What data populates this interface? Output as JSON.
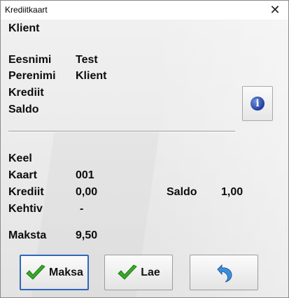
{
  "window": {
    "title": "Krediitkaart",
    "close_label": "✕"
  },
  "section_title": "Klient",
  "client": {
    "first_name_label": "Eesnimi",
    "first_name": "Test",
    "last_name_label": "Perenimi",
    "last_name": "Klient",
    "credit_label": "Krediit",
    "balance_label": "Saldo"
  },
  "card": {
    "language_label": "Keel",
    "card_label": "Kaart",
    "card_number": "001",
    "credit_label": "Krediit",
    "credit": "0,00",
    "balance_label": "Saldo",
    "balance": "1,00",
    "valid_label": "Kehtiv",
    "valid": "-",
    "pay_label": "Maksta",
    "pay_amount": "9,50"
  },
  "buttons": {
    "pay": "Maksa",
    "load": "Lae",
    "info_icon": "info-icon",
    "undo_icon": "undo-arrow-icon"
  },
  "colors": {
    "default_button_border": "#2f67b8",
    "check": "#3aa82a",
    "undo": "#3b8fd6"
  }
}
